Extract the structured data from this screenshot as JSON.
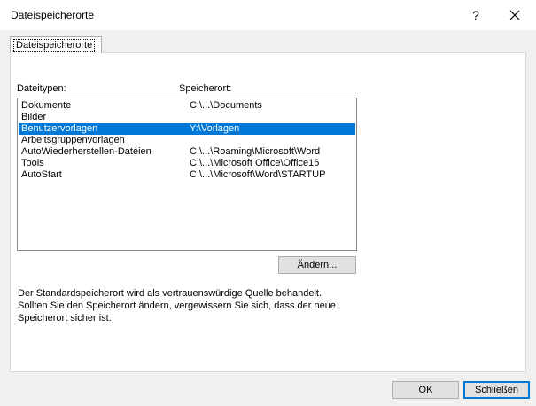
{
  "window": {
    "title": "Dateispeicherorte",
    "help_glyph": "?",
    "close_icon": "close-icon"
  },
  "tab": {
    "label": "Dateispeicherorte"
  },
  "list": {
    "header_type": "Dateitypen:",
    "header_location": "Speicherort:",
    "rows": [
      {
        "type": "Dokumente",
        "location": "C:\\...\\Documents",
        "selected": false
      },
      {
        "type": "Bilder",
        "location": "",
        "selected": false
      },
      {
        "type": "Benutzervorlagen",
        "location": "Y:\\Vorlagen",
        "selected": true
      },
      {
        "type": "Arbeitsgruppenvorlagen",
        "location": "",
        "selected": false
      },
      {
        "type": "AutoWiederherstellen-Dateien",
        "location": "C:\\...\\Roaming\\Microsoft\\Word",
        "selected": false
      },
      {
        "type": "Tools",
        "location": "C:\\...\\Microsoft Office\\Office16",
        "selected": false
      },
      {
        "type": "AutoStart",
        "location": "C:\\...\\Microsoft\\Word\\STARTUP",
        "selected": false
      }
    ]
  },
  "buttons": {
    "aendern_prefix": "Ä",
    "aendern_rest": "ndern...",
    "ok": "OK",
    "close": "Schließen"
  },
  "info": {
    "line1": "Der Standardspeicherort wird als vertrauenswürdige Quelle behandelt.",
    "line2": "Sollten Sie den Speicherort ändern, vergewissern Sie sich, dass der neue",
    "line3": "Speicherort sicher ist."
  },
  "colors": {
    "selection": "#0078d7",
    "default_button_border": "#0078d7"
  }
}
